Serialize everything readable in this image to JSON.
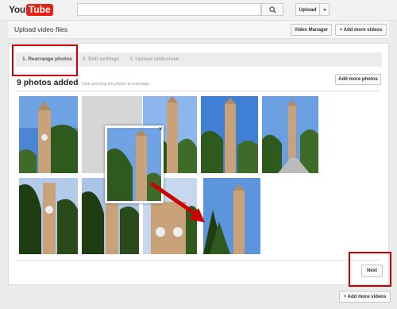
{
  "brand": {
    "you": "You",
    "tube": "Tube"
  },
  "search": {
    "placeholder": ""
  },
  "toolbar": {
    "upload_label": "Upload"
  },
  "header": {
    "title": "Upload video files",
    "video_manager": "Video Manager",
    "add_more_videos": "+ Add more videos"
  },
  "steps": [
    {
      "label": "1. Rearrange photos"
    },
    {
      "label": "2. Edit settings"
    },
    {
      "label": "3. Upload slideshow"
    }
  ],
  "photos": {
    "count_label": "9 photos added",
    "hint": "Click and drag the photos to rearrange",
    "add_more_photos": "Add more photos"
  },
  "footer": {
    "next": "Next",
    "add_more_videos": "+ Add more videos"
  },
  "colors": {
    "brand_red": "#e62117",
    "highlight_red": "#cc0000",
    "sky": "#4a86d4",
    "tower": "#c9a27a",
    "tree": "#2f5a1e"
  }
}
